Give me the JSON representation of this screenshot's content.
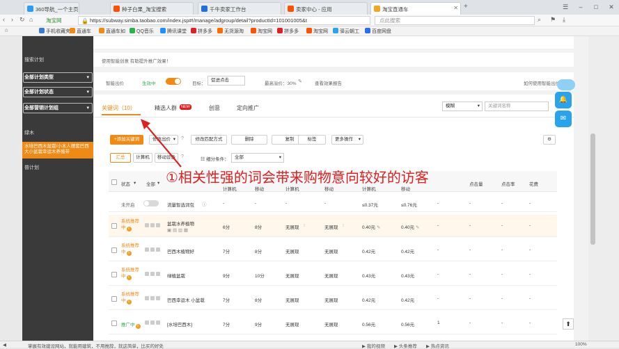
{
  "tabs": [
    {
      "title": "360导航_一个主页，整个世界",
      "color": "#2a9df4"
    },
    {
      "title": "种子白果_淘宝搜索",
      "color": "#ff5000"
    },
    {
      "title": "千牛卖家工作台",
      "color": "#1e6fe0"
    },
    {
      "title": "卖家中心 - 应用",
      "color": "#ff5000"
    },
    {
      "title": "淘宝直通车",
      "color": "#f5a623"
    }
  ],
  "address": {
    "url": "https://subway.simba.taobao.com/index.jsp#!/manage/adgroup/detail?productId=101001005&t",
    "prefix": "淘宝网",
    "search_placeholder": "点此搜索"
  },
  "bookmarks": [
    "手机收藏夹",
    "直通车",
    "直通车如",
    "QQ音乐",
    "腾讯课堂",
    "拼多多",
    "无货源淘",
    "淘宝网",
    "拼多多",
    "淘宝网",
    "驿云朝工",
    "百度网盘"
  ],
  "sidebar": {
    "heading": "搜索计划",
    "selects": [
      "全部计划类型",
      "全部计划状态",
      "全部营销计划组"
    ],
    "items": [
      "绿木",
      "水培巴西木盆栽/小木人摆套巴西大小盆栽幸运木养殖带"
    ],
    "footer": "普计划"
  },
  "notice": "使用智能创意 有助提升推广效果！",
  "controls": {
    "smart_bid_label": "智能出价",
    "status": "生效中",
    "target_label": "目标：",
    "target_value": "促进点击",
    "max_premium": "最高溢价：30%",
    "view_report": "查看效果报告",
    "how_to": "如何使用智能出价"
  },
  "tabs_main": [
    {
      "label": "关键词（10）",
      "badge": ""
    },
    {
      "label": "精选人群",
      "badge": "NEW"
    },
    {
      "label": "创意",
      "badge": ""
    },
    {
      "label": "定向推广",
      "badge": ""
    }
  ],
  "filter": {
    "select": "模糊",
    "placeholder": "关键词名称"
  },
  "toolbar": {
    "add": "+添加关键词",
    "change_bid": "修改出价",
    "change_match": "修改匹配方式",
    "delete": "删除",
    "copy": "复制",
    "tag": "标签",
    "more": "更多操作"
  },
  "subtabs": [
    "汇总",
    "计算机",
    "移动设备"
  ],
  "detail": {
    "label": "细分条件：",
    "value": "全部"
  },
  "table": {
    "headers": {
      "status": "状态",
      "all": "全部",
      "pc": "计算机",
      "mobile": "移动",
      "pc2": "计算机",
      "mobile2": "移动",
      "pc3": "计算机",
      "mobile3": "移动",
      "clicks": "点击量",
      "ctr": "点击率",
      "cost": "花费"
    },
    "default_row": {
      "status": "未开启",
      "name": "流量智选词包",
      "price_pc": "≤0.37元",
      "price_m": "≤0.76元"
    },
    "rows": [
      {
        "status": "系统推荐中",
        "name": "盆栽水养植物",
        "q_pc": "6分",
        "q_m": "8分",
        "rank_pc": "无展现",
        "rank_m": "无展现",
        "bid_pc": "0.40元",
        "bid_m": "0.40元",
        "clicks": "",
        "highlight": true
      },
      {
        "status": "系统推荐中",
        "name": "巴西木植物好",
        "q_pc": "7分",
        "q_m": "8分",
        "rank_pc": "无展现",
        "rank_m": "无展现",
        "bid_pc": "0.42元",
        "bid_m": "0.42元",
        "clicks": "",
        "highlight": false
      },
      {
        "status": "系统推荐中",
        "name": "绿植盆栽",
        "q_pc": "9分",
        "q_m": "10分",
        "rank_pc": "无展现",
        "rank_m": "无展现",
        "bid_pc": "0.43元",
        "bid_m": "0.43元",
        "clicks": "",
        "highlight": false
      },
      {
        "status": "系统推荐中",
        "name": "巴西幸运木 小盆栽",
        "q_pc": "7分",
        "q_m": "8分",
        "rank_pc": "无展现",
        "rank_m": "无展现",
        "bid_pc": "0.42元",
        "bid_m": "0.42元",
        "clicks": "",
        "highlight": false
      },
      {
        "status": "推广中",
        "name": "[水培巴西木]",
        "q_pc": "7分",
        "q_m": "9分",
        "rank_pc": "无展现",
        "rank_m": "无展现",
        "bid_pc": "0.56元",
        "bid_m": "0.56元",
        "clicks": "1",
        "highlight": false
      }
    ],
    "dash": "-"
  },
  "annotation": "①相关性强的词会带来购物意向较好的访客",
  "statusbar": {
    "left": "掌握有效建设网站，就能用建筑，不用推辞，就这简单，比买的好处",
    "items": [
      "我的视频",
      "头条推荐",
      "热点资讯"
    ],
    "zoom": "100%"
  },
  "colors": {
    "accent": "#f08a14",
    "sidebar": "#3a3a3a",
    "annotation": "#e02020",
    "float": "#2aa3ef"
  }
}
